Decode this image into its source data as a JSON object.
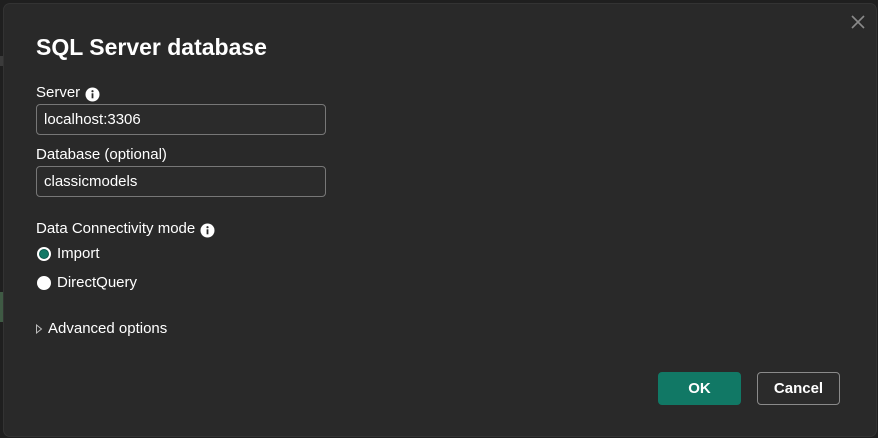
{
  "dialog": {
    "title": "SQL Server database",
    "close_icon": "close-icon"
  },
  "server": {
    "label": "Server",
    "info_icon": "info-icon",
    "value": "localhost:3306"
  },
  "database": {
    "label": "Database (optional)",
    "value": "classicmodels"
  },
  "connectivity": {
    "label": "Data Connectivity mode",
    "info_icon": "info-icon",
    "options": [
      {
        "label": "Import",
        "selected": true
      },
      {
        "label": "DirectQuery",
        "selected": false
      }
    ]
  },
  "advanced": {
    "label": "Advanced options",
    "icon": "chevron-right-icon"
  },
  "buttons": {
    "ok_label": "OK",
    "cancel_label": "Cancel"
  },
  "colors": {
    "accent": "#117865",
    "dialog_background": "#292929",
    "text": "#ffffff"
  }
}
